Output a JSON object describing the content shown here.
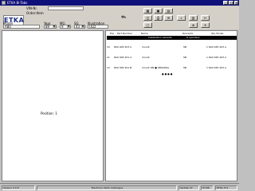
{
  "window": {
    "title": "ETKA Bi-Tabs"
  },
  "header": {
    "vin_label": "VIN-Nr.",
    "order_label": "Order-Item",
    "logo_text": "ETKA",
    "model_label": "Model",
    "year_label": "Year",
    "mg_label": "MG",
    "sg_label": "SG",
    "illustration_label": "Illustration",
    "model_value": "A80",
    "year_value": "89",
    "mg_value": "9",
    "sg_value": "43",
    "illustration_value": "ULD"
  },
  "toolbar": {
    "buttons": [
      "▦",
      "▣",
      "▤",
      "◫",
      "⎙",
      "✉",
      "⌕",
      "▥",
      "✂",
      "▢",
      "⊕",
      "✕"
    ]
  },
  "left": {
    "position_label": "Position: 1"
  },
  "table": {
    "headers": {
      "pos": "Pos",
      "part": "Part Number",
      "name": "Name",
      "remarks": "Remarks",
      "qty": "Qty Model"
    },
    "highlight": [
      "Installation variants",
      "6 cylinders"
    ],
    "rows": [
      {
        "pos": "10",
        "part": "8A0 945 203 A",
        "name": "mount",
        "remarks": "SB",
        "qty": "1 8A0 945 203 A"
      },
      {
        "pos": "11",
        "part": "8A0 945 201 A",
        "name": "mount",
        "remarks": "SB",
        "qty": "1 8A0 945 203 A"
      },
      {
        "pos": "12",
        "part": "8A0 945 201 B",
        "name": "mount ON ● ORIGINAL",
        "remarks": "SB",
        "qty": "1 8A0 945 203 A"
      }
    ],
    "ellipsis": "● ● ● ●"
  },
  "status": {
    "version": "Version 5.0 E",
    "center": "Electronic Parts Catalogue",
    "update": "Update 37",
    "date": "07/96",
    "code": "ETKA 371"
  }
}
